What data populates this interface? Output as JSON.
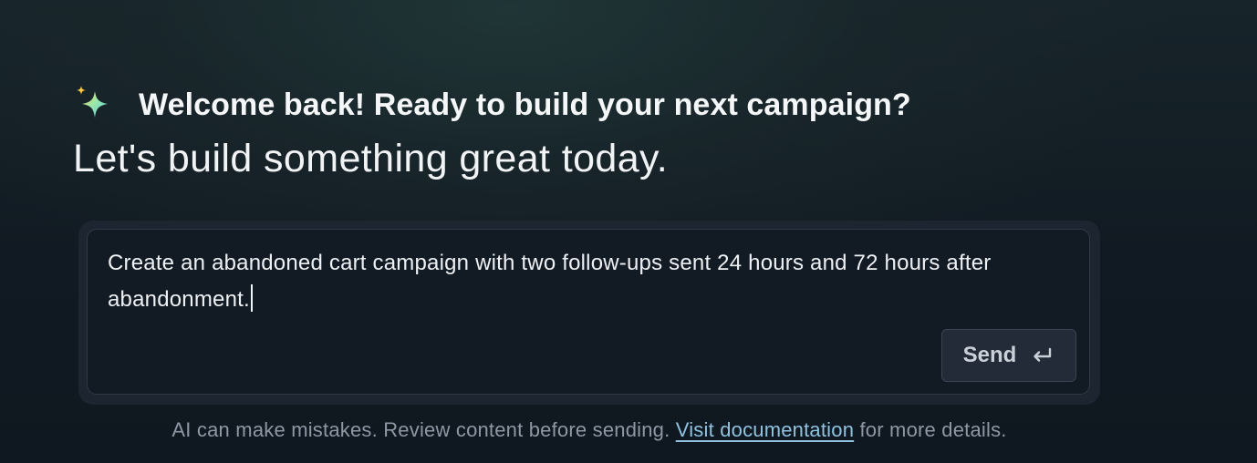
{
  "header": {
    "icon": "sparkle-icon",
    "welcome_title": "Welcome back! Ready to build your next campaign?",
    "subtitle": "Let's build something great today."
  },
  "composer": {
    "prompt_text": "Create an abandoned cart campaign with two follow-ups sent 24 hours and 72 hours after abandonment.",
    "send_label": "Send",
    "send_icon": "enter-return-icon"
  },
  "footer": {
    "disclaimer_before": "AI can make mistakes. Review content before sending.",
    "link_text": "Visit documentation",
    "disclaimer_after": "for more details."
  },
  "colors": {
    "sparkle_primary": "#7ee3c8",
    "sparkle_accent": "#f5c84c",
    "link": "#8fc3df"
  }
}
